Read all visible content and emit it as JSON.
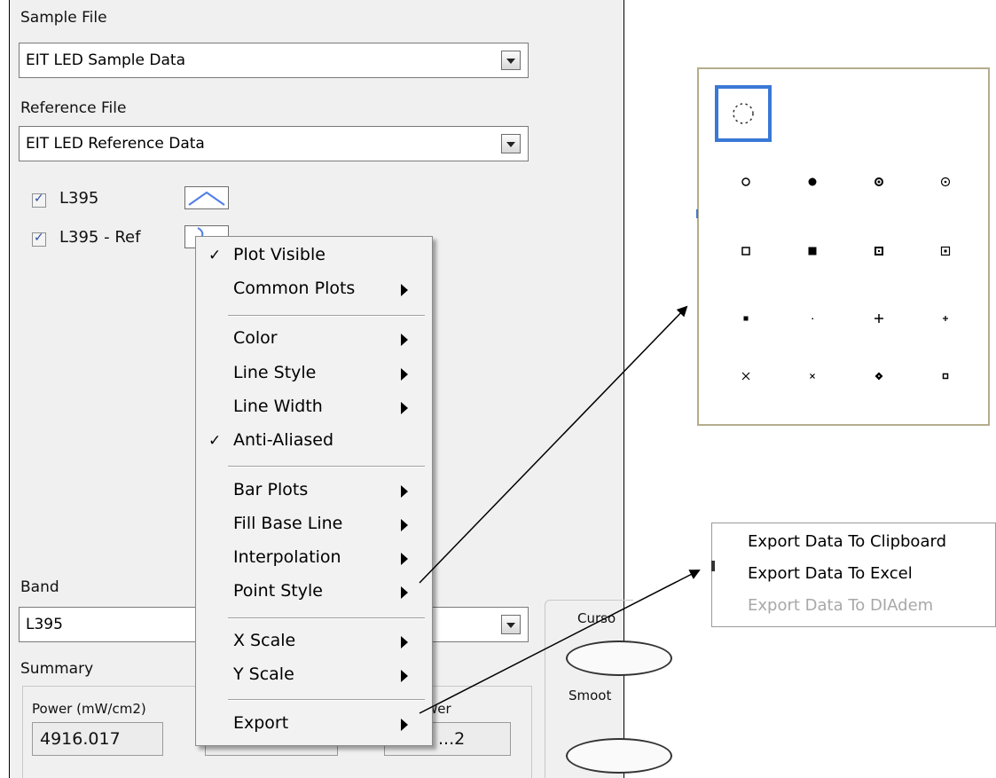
{
  "sample_file": {
    "label": "Sample File",
    "value": "EIT LED Sample Data"
  },
  "reference_file": {
    "label": "Reference File",
    "value": "EIT LED Reference Data"
  },
  "plots": [
    {
      "name": "L395",
      "checked": true
    },
    {
      "name": "L395 - Ref",
      "checked": true
    }
  ],
  "band": {
    "label": "Band",
    "value": "L395"
  },
  "summary": {
    "label": "Summary",
    "fields": [
      {
        "label": "Power (mW/cm2)",
        "value": "4916.017"
      },
      {
        "label": "",
        "value": ""
      },
      {
        "label": "wer",
        "value": "...2"
      }
    ]
  },
  "right_controls": {
    "cursor_label": "Curso",
    "smooth_label": "Smoot"
  },
  "context_menu": {
    "items": [
      {
        "label": "Plot Visible",
        "checked": true,
        "submenu": false
      },
      {
        "label": "Common Plots",
        "checked": false,
        "submenu": true
      },
      {
        "label": "Color",
        "checked": false,
        "submenu": true
      },
      {
        "label": "Line Style",
        "checked": false,
        "submenu": true
      },
      {
        "label": "Line Width",
        "checked": false,
        "submenu": true
      },
      {
        "label": "Anti-Aliased",
        "checked": true,
        "submenu": false
      },
      {
        "label": "Bar Plots",
        "checked": false,
        "submenu": true
      },
      {
        "label": "Fill Base Line",
        "checked": false,
        "submenu": true
      },
      {
        "label": "Interpolation",
        "checked": false,
        "submenu": true
      },
      {
        "label": "Point Style",
        "checked": false,
        "submenu": true
      },
      {
        "label": "X Scale",
        "checked": false,
        "submenu": true
      },
      {
        "label": "Y Scale",
        "checked": false,
        "submenu": true
      },
      {
        "label": "Export",
        "checked": false,
        "submenu": true
      }
    ]
  },
  "point_style_palette": {
    "selected": "dashed-circle",
    "rows": [
      [
        "hollow-circle",
        "filled-circle",
        "dot-circle",
        "bullseye-circle"
      ],
      [
        "hollow-square",
        "filled-square",
        "dot-square",
        "nested-square"
      ],
      [
        "small-square",
        "dot",
        "plus",
        "small-cross"
      ],
      [
        "x-mark",
        "small-x",
        "diamond",
        "tiny-square"
      ]
    ]
  },
  "export_menu": {
    "items": [
      {
        "label": "Export Data To Clipboard",
        "enabled": true
      },
      {
        "label": "Export Data To Excel",
        "enabled": true
      },
      {
        "label": "Export Data To DIAdem",
        "enabled": false
      }
    ]
  },
  "colors": {
    "selection_blue": "#3a78d6",
    "disabled_gray": "#a8a8a8",
    "palette_border": "#b4ac8c"
  }
}
